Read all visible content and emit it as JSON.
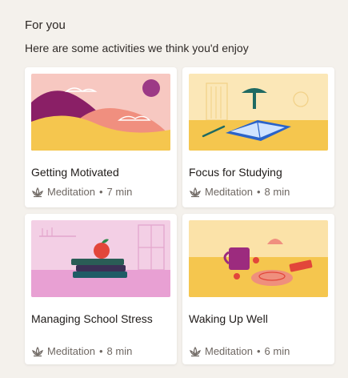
{
  "section": {
    "title": "For you",
    "subtitle": "Here are some activities we think you'd enjoy"
  },
  "cards": [
    {
      "title": "Getting Motivated",
      "category": "Meditation",
      "separator": "•",
      "duration": "7 min"
    },
    {
      "title": "Focus for Studying",
      "category": "Meditation",
      "separator": "•",
      "duration": "8 min"
    },
    {
      "title": "Managing School Stress",
      "category": "Meditation",
      "separator": "•",
      "duration": "8 min"
    },
    {
      "title": "Waking Up Well",
      "category": "Meditation",
      "separator": "•",
      "duration": "6 min"
    }
  ],
  "icons": {
    "meditation": "lotus-icon"
  },
  "colors": {
    "background": "#f4f1ec",
    "card": "#ffffff",
    "meta_text": "#6e6762",
    "accent_yellow": "#f5c64e",
    "accent_pink": "#f3b7b0",
    "accent_purple": "#8a2a74"
  }
}
